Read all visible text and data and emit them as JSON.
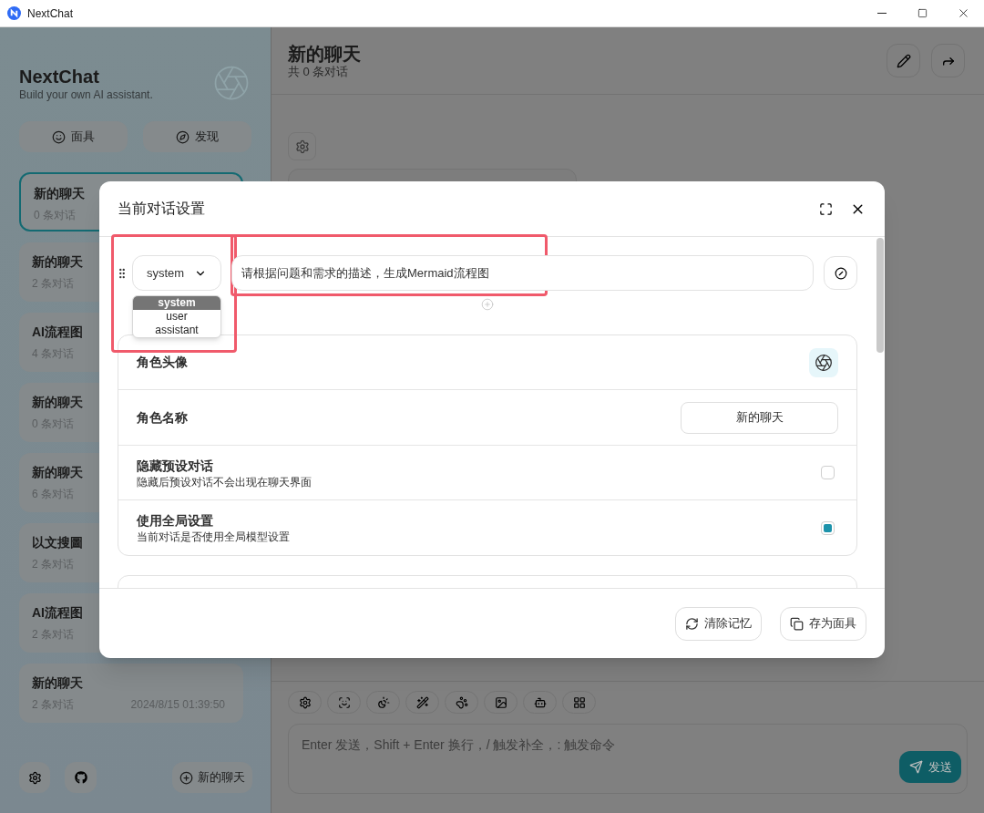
{
  "window": {
    "title": "NextChat"
  },
  "sidebar": {
    "title": "NextChat",
    "subtitle": "Build your own AI assistant.",
    "buttons": [
      {
        "label": "面具"
      },
      {
        "label": "发现"
      }
    ],
    "chats": [
      {
        "title": "新的聊天",
        "count": "0 条对话",
        "selected": true
      },
      {
        "title": "新的聊天",
        "count": "2 条对话",
        "selected": false
      },
      {
        "title": "AI流程图",
        "count": "4 条对话",
        "selected": false
      },
      {
        "title": "新的聊天",
        "count": "0 条对话",
        "selected": false
      },
      {
        "title": "新的聊天",
        "count": "6 条对话",
        "selected": false
      },
      {
        "title": "以文搜圖",
        "count": "2 条对话",
        "selected": false
      },
      {
        "title": "AI流程图",
        "count": "2 条对话",
        "selected": false
      },
      {
        "title": "新的聊天",
        "count": "2 条对话",
        "date": "2024/8/15 01:39:50",
        "selected": false
      }
    ],
    "new_chat": "新的聊天"
  },
  "header": {
    "title": "新的聊天",
    "subtitle": "共 0 条对话"
  },
  "composer": {
    "placeholder": "Enter 发送，Shift + Enter 换行，/ 触发补全，: 触发命令",
    "send": "发送"
  },
  "modal": {
    "title": "当前对话设置",
    "message": {
      "role": "system",
      "content": "请根据问题和需求的描述，生成Mermaid流程图",
      "options": [
        {
          "label": "system",
          "selected": true
        },
        {
          "label": "user",
          "selected": false
        },
        {
          "label": "assistant",
          "selected": false
        }
      ]
    },
    "rows": [
      {
        "kind": "avatar",
        "label": "角色头像"
      },
      {
        "kind": "text",
        "label": "角色名称",
        "value": "新的聊天"
      },
      {
        "kind": "checkbox",
        "label": "隐藏预设对话",
        "description": "隐藏后预设对话不会出现在聊天界面",
        "checked": false
      },
      {
        "kind": "checkbox",
        "label": "使用全局设置",
        "description": "当前对话是否使用全局模型设置",
        "checked": true
      }
    ],
    "buttons": [
      {
        "label": "清除记忆"
      },
      {
        "label": "存为面具"
      }
    ]
  }
}
